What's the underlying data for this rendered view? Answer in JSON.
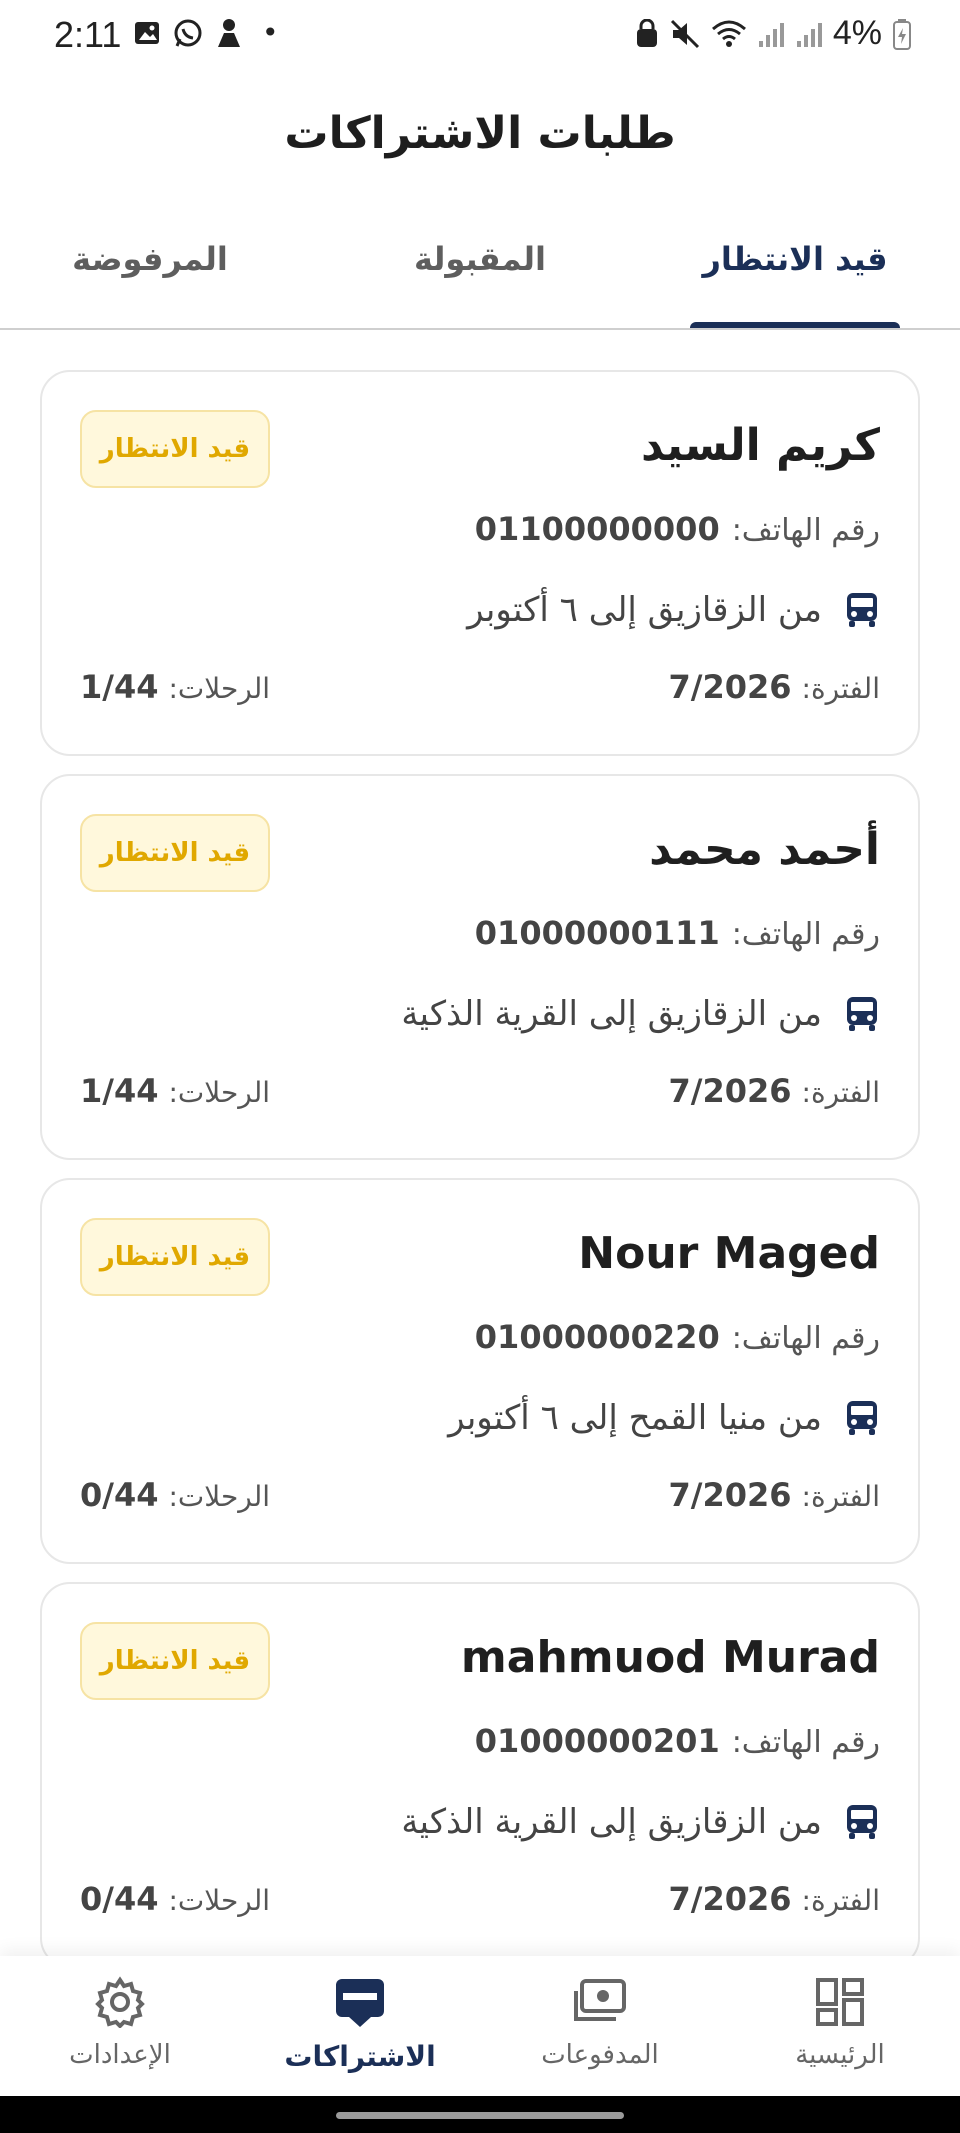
{
  "status_bar": {
    "time": "2:11",
    "battery": "4%"
  },
  "header": {
    "title": "طلبات الاشتراكات"
  },
  "tabs": [
    {
      "label": "قيد الانتظار",
      "active": true
    },
    {
      "label": "المقبولة",
      "active": false
    },
    {
      "label": "المرفوضة",
      "active": false
    }
  ],
  "labels": {
    "phone": "رقم الهاتف:",
    "period": "الفترة:",
    "trips": "الرحلات:"
  },
  "requests": [
    {
      "name": "كريم السيد",
      "status": "قيد الانتظار",
      "phone": "01100000000",
      "route": "من الزقازيق إلى ٦ أكتوبر",
      "period": "7/2026",
      "trips": "1/44"
    },
    {
      "name": "أحمد محمد",
      "status": "قيد الانتظار",
      "phone": "01000000111",
      "route": "من الزقازيق إلى القرية الذكية",
      "period": "7/2026",
      "trips": "1/44"
    },
    {
      "name": "Nour Maged",
      "status": "قيد الانتظار",
      "phone": "01000000220",
      "route": "من منيا القمح إلى ٦ أكتوبر",
      "period": "7/2026",
      "trips": "0/44"
    },
    {
      "name": "mahmuod Murad",
      "status": "قيد الانتظار",
      "phone": "01000000201",
      "route": "من الزقازيق إلى القرية الذكية",
      "period": "7/2026",
      "trips": "0/44"
    }
  ],
  "bottom_nav": [
    {
      "label": "الرئيسية",
      "icon": "dashboard-icon",
      "active": false
    },
    {
      "label": "المدفوعات",
      "icon": "payments-icon",
      "active": false
    },
    {
      "label": "الاشتراكات",
      "icon": "subscriptions-icon",
      "active": true
    },
    {
      "label": "الإعدادات",
      "icon": "gear-icon",
      "active": false
    }
  ],
  "colors": {
    "primary": "#1b2f57",
    "pending_text": "#e0a800",
    "pending_bg": "#fff8dc"
  }
}
